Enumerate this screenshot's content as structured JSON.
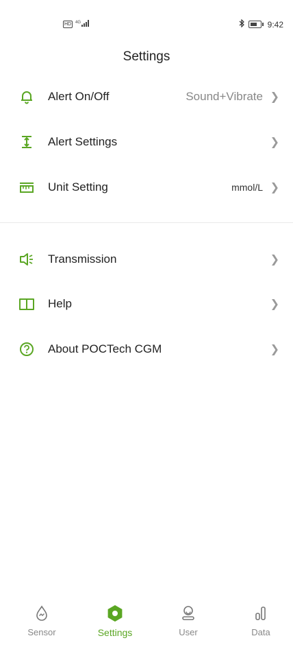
{
  "status_bar": {
    "network_badge": "HD",
    "signal_text": "4G",
    "time": "9:42"
  },
  "header": {
    "title": "Settings"
  },
  "accent_color": "#5aa623",
  "settings_items": [
    {
      "label": "Alert On/Off",
      "value": "Sound+Vibrate",
      "icon": "bell-icon"
    },
    {
      "label": "Alert Settings",
      "value": "",
      "icon": "alert-range-icon"
    },
    {
      "label": "Unit Setting",
      "value": "mmol/L",
      "icon": "ruler-icon"
    },
    {
      "label": "Transmission",
      "value": "",
      "icon": "speaker-icon"
    },
    {
      "label": "Help",
      "value": "",
      "icon": "book-icon"
    },
    {
      "label": "About POCTech CGM",
      "value": "",
      "icon": "question-icon"
    }
  ],
  "bottom_nav": [
    {
      "label": "Sensor",
      "icon": "sensor-drop-icon",
      "active": false
    },
    {
      "label": "Settings",
      "icon": "settings-gear-icon",
      "active": true
    },
    {
      "label": "User",
      "icon": "user-icon",
      "active": false
    },
    {
      "label": "Data",
      "icon": "bar-chart-icon",
      "active": false
    }
  ]
}
